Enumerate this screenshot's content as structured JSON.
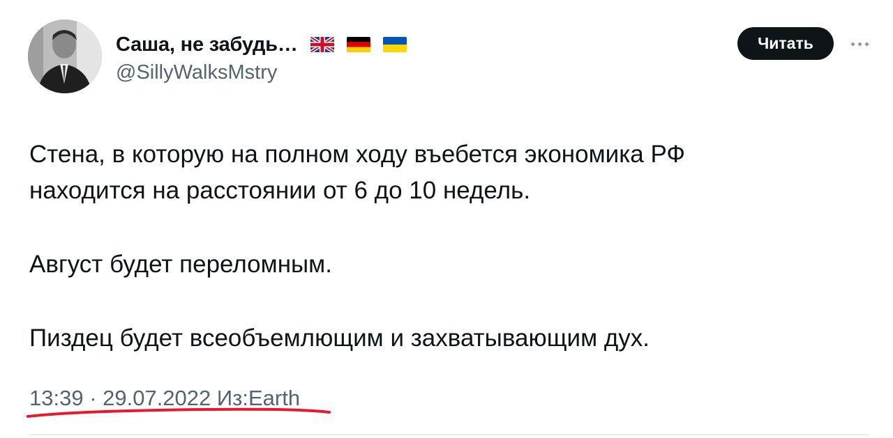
{
  "user": {
    "display_name": "Саша, не забудь…",
    "handle": "@SillyWalksMstry",
    "flags": [
      "uk-flag-icon",
      "germany-flag-icon",
      "ukraine-flag-icon"
    ]
  },
  "actions": {
    "follow_label": "Читать",
    "more_icon": "more-dots-icon"
  },
  "tweet": {
    "line1": "Стена, в которую на полном ходу въебется экономика РФ",
    "line2": "находится на расстоянии от 6 до 10 недель.",
    "line3": "Август будет переломным.",
    "line4": "Пиздец будет всеобъемлющим и захватывающим дух.",
    "meta": "13:39 · 29.07.2022 Из:Earth"
  },
  "colors": {
    "text": "#0f1419",
    "secondary": "#536471",
    "button_bg": "#0f1419",
    "button_text": "#ffffff",
    "annotation_red": "#e8192c"
  }
}
